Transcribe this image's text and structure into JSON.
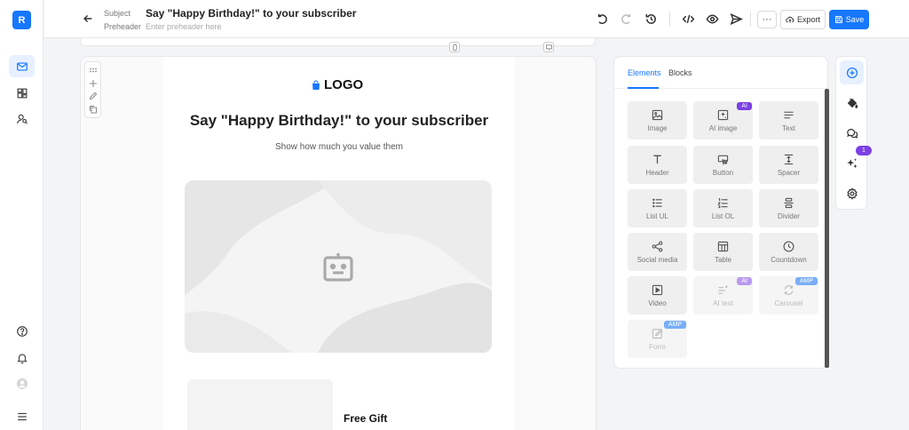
{
  "app": {
    "logo_letter": "R"
  },
  "header": {
    "subject_label": "Subject",
    "subject_value": "Say \"Happy Birthday!\" to your subscriber",
    "preheader_label": "Preheader",
    "preheader_placeholder": "Enter preheader here",
    "more_label": "···",
    "export_label": "Export",
    "save_label": "Save"
  },
  "email": {
    "logo_text": "LOGO",
    "title": "Say \"Happy Birthday!\" to your subscriber",
    "subtitle": "Show how much you value them",
    "card_title": "Free Gift"
  },
  "panel": {
    "tabs": [
      {
        "label": "Elements",
        "active": true
      },
      {
        "label": "Blocks",
        "active": false
      }
    ],
    "elements": [
      {
        "label": "Image",
        "icon": "image-icon",
        "badge": "",
        "disabled": false
      },
      {
        "label": "AI image",
        "icon": "ai-image-icon",
        "badge": "AI",
        "disabled": false
      },
      {
        "label": "Text",
        "icon": "text-icon",
        "badge": "",
        "disabled": false
      },
      {
        "label": "Header",
        "icon": "header-icon",
        "badge": "",
        "disabled": false
      },
      {
        "label": "Button",
        "icon": "button-icon",
        "badge": "",
        "disabled": false
      },
      {
        "label": "Spacer",
        "icon": "spacer-icon",
        "badge": "",
        "disabled": false
      },
      {
        "label": "List UL",
        "icon": "list-ul-icon",
        "badge": "",
        "disabled": false
      },
      {
        "label": "List OL",
        "icon": "list-ol-icon",
        "badge": "",
        "disabled": false
      },
      {
        "label": "Divider",
        "icon": "divider-icon",
        "badge": "",
        "disabled": false
      },
      {
        "label": "Social media",
        "icon": "share-icon",
        "badge": "",
        "disabled": false
      },
      {
        "label": "Table",
        "icon": "table-icon",
        "badge": "",
        "disabled": false
      },
      {
        "label": "Countdown",
        "icon": "clock-icon",
        "badge": "",
        "disabled": false
      },
      {
        "label": "Video",
        "icon": "video-icon",
        "badge": "",
        "disabled": false
      },
      {
        "label": "AI text",
        "icon": "ai-text-icon",
        "badge": "AI",
        "disabled": true
      },
      {
        "label": "Carousel",
        "icon": "carousel-icon",
        "badge": "AMP",
        "disabled": true
      },
      {
        "label": "Form",
        "icon": "form-icon",
        "badge": "AMP",
        "disabled": true
      }
    ]
  },
  "right_rail": {
    "notification_count": "1"
  },
  "colors": {
    "accent": "#1677ff",
    "ai_badge": "#7b3fe4",
    "amp_badge": "#78aef7"
  }
}
